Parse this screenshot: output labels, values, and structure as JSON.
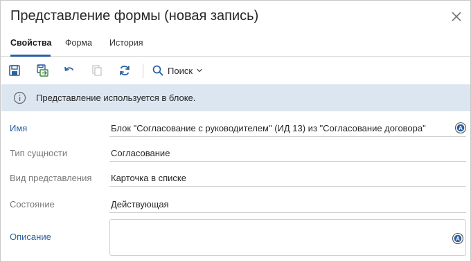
{
  "header": {
    "title": "Представление формы (новая запись)"
  },
  "tabs": [
    {
      "label": "Свойства"
    },
    {
      "label": "Форма"
    },
    {
      "label": "История"
    }
  ],
  "toolbar": {
    "search_label": "Поиск",
    "icons": [
      "save-icon",
      "save-and-close-icon",
      "undo-icon",
      "copy-icon",
      "refresh-icon",
      "search-icon",
      "chevron-down-icon"
    ]
  },
  "info": {
    "text": "Представление используется в блоке."
  },
  "fields": {
    "name": {
      "label": "Имя",
      "value": "Блок \"Согласование с руководителем\" (ИД 13) из \"Согласование договора\""
    },
    "entity_type": {
      "label": "Тип сущности",
      "value": "Согласование"
    },
    "view_kind": {
      "label": "Вид представления",
      "value": "Карточка в списке"
    },
    "state": {
      "label": "Состояние",
      "value": "Действующая"
    },
    "description": {
      "label": "Описание",
      "value": ""
    }
  },
  "colors": {
    "accent": "#2a5fa0",
    "info_bg": "#dce6f1",
    "toolbar_icon": "#2a5fa0"
  }
}
